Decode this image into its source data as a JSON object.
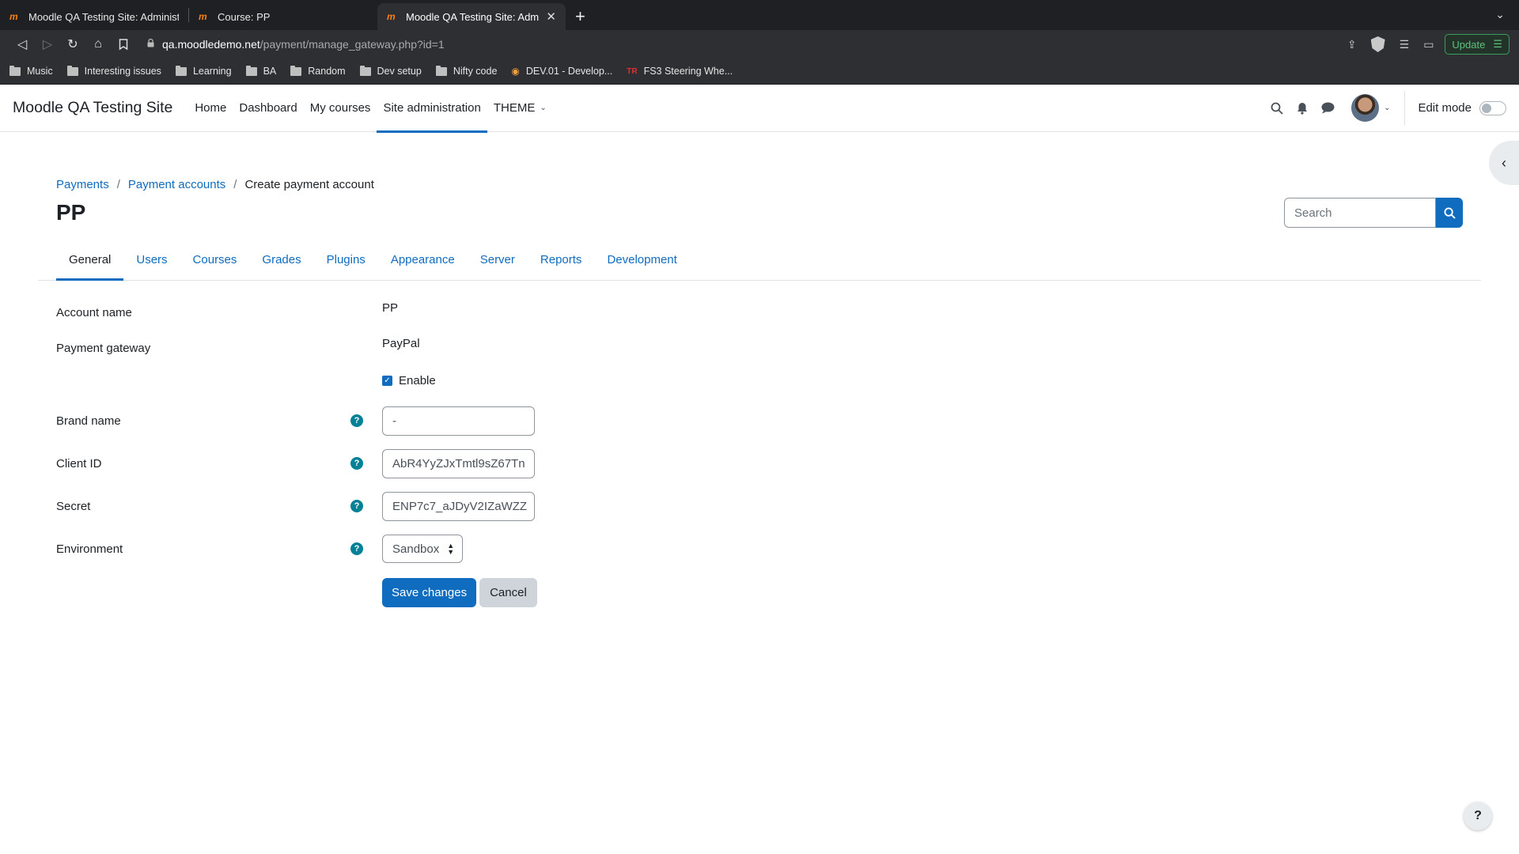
{
  "browser": {
    "tabs": [
      {
        "title": "Moodle QA Testing Site: Administrat",
        "favicon": "m",
        "active": false
      },
      {
        "title": "Course: PP",
        "favicon": "m",
        "active": false
      },
      {
        "title": "Moodle QA Testing Site: Admini",
        "favicon": "m",
        "active": true
      }
    ],
    "new_tab": "+",
    "url_host": "qa.moodledemo.net",
    "url_path": "/payment/manage_gateway.php?id=1",
    "update_label": "Update",
    "bookmarks": [
      {
        "label": "Music",
        "icon": "folder-icon"
      },
      {
        "label": "Interesting issues",
        "icon": "folder-icon"
      },
      {
        "label": "Learning",
        "icon": "folder-icon"
      },
      {
        "label": "BA",
        "icon": "folder-icon"
      },
      {
        "label": "Random",
        "icon": "folder-icon"
      },
      {
        "label": "Dev setup",
        "icon": "folder-icon"
      },
      {
        "label": "Nifty code",
        "icon": "folder-icon"
      },
      {
        "label": "DEV.01 - Develop...",
        "icon": "site-favicon"
      },
      {
        "label": "FS3 Steering Whe...",
        "icon": "site-favicon"
      }
    ]
  },
  "navbar": {
    "site_name": "Moodle QA Testing Site",
    "items": [
      {
        "label": "Home",
        "active": false
      },
      {
        "label": "Dashboard",
        "active": false
      },
      {
        "label": "My courses",
        "active": false
      },
      {
        "label": "Site administration",
        "active": true
      },
      {
        "label": "THEME",
        "active": false
      }
    ],
    "edit_mode_label": "Edit mode",
    "edit_mode_on": false
  },
  "breadcrumb": [
    "Payments",
    "Payment accounts",
    "Create payment account"
  ],
  "page_title": "PP",
  "search": {
    "placeholder": "Search"
  },
  "tabs": [
    "General",
    "Users",
    "Courses",
    "Grades",
    "Plugins",
    "Appearance",
    "Server",
    "Reports",
    "Development"
  ],
  "form": {
    "account_name_label": "Account name",
    "account_name_value": "PP",
    "gateway_label": "Payment gateway",
    "gateway_value": "PayPal",
    "enable_label": "Enable",
    "enable_checked": true,
    "brand_label": "Brand name",
    "brand_value": "-",
    "client_id_label": "Client ID",
    "client_id_value": "AbR4YyZJxTmtl9sZ67Tn",
    "secret_label": "Secret",
    "secret_value": "ENP7c7_aJDyV2IZaWZZ",
    "environment_label": "Environment",
    "environment_value": "Sandbox",
    "save_label": "Save changes",
    "cancel_label": "Cancel"
  },
  "help_fab": "?",
  "colors": {
    "primary": "#0f6cbf",
    "help_icon": "#008196",
    "chrome_dark": "#1f2023",
    "moodle_orange": "#f98012"
  }
}
